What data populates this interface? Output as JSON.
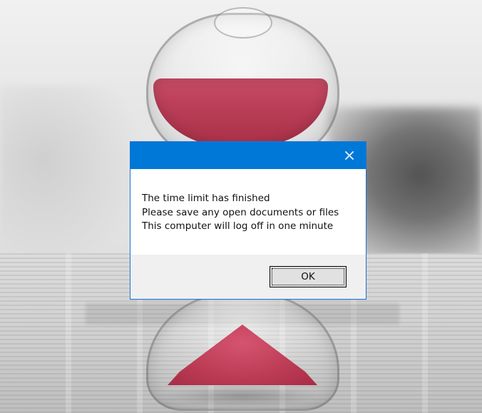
{
  "background": {
    "dominant_colors": {
      "sand": "#b93d56",
      "paper": "#d6d6d6",
      "blur_dark": "#5a5a5a"
    }
  },
  "dialog": {
    "title": "",
    "close_icon": "close-icon",
    "message_lines": [
      "The time limit has finished",
      "Please save any open documents or files",
      "This computer will log off in one minute"
    ],
    "ok_label": "OK",
    "colors": {
      "titlebar": "#0078d7",
      "footer": "#f0f0f0",
      "button": "#e1e1e1"
    }
  }
}
